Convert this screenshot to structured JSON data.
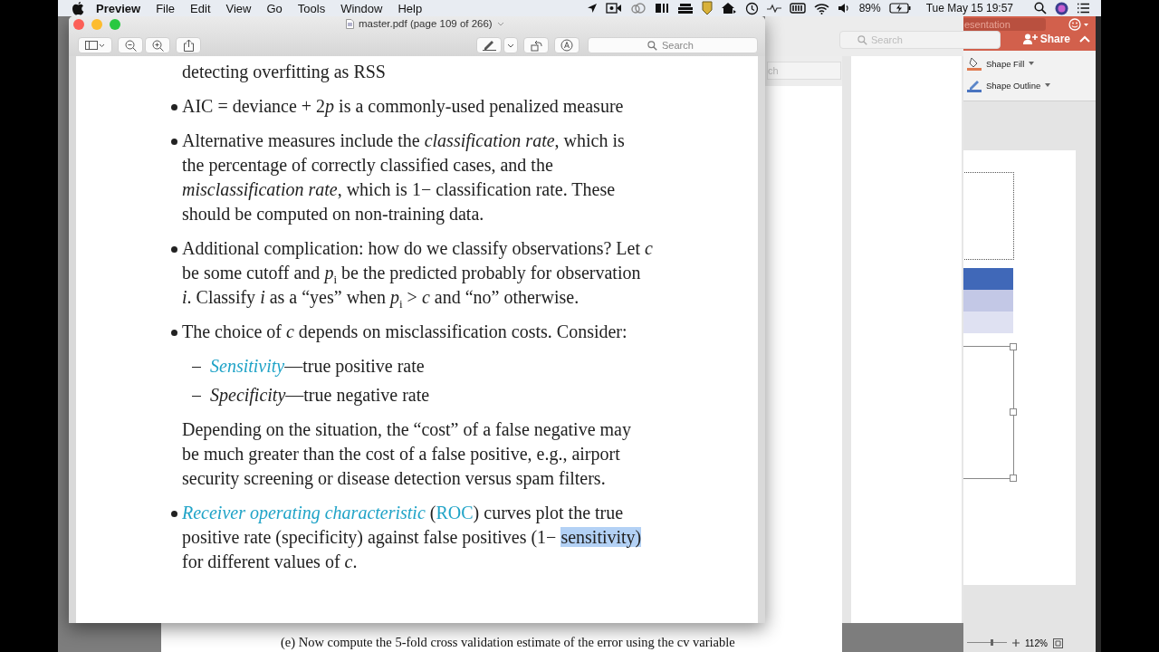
{
  "menu_bar": {
    "app": "Preview",
    "menus": [
      "File",
      "Edit",
      "View",
      "Go",
      "Tools",
      "Window",
      "Help"
    ],
    "battery": "89%",
    "clock": "Tue May 15  19:57"
  },
  "preview_window": {
    "title": "master.pdf (page 109 of 266)",
    "search": {
      "placeholder": "Search"
    },
    "document": [
      {
        "kind": "continuation",
        "lines": [
          [
            {
              "kind": "text",
              "t": "detecting overfitting as RSS"
            }
          ]
        ]
      },
      {
        "kind": "bullet",
        "lines": [
          [
            {
              "kind": "text",
              "t": "AIC = deviance + 2"
            },
            {
              "kind": "math",
              "t": "p"
            },
            {
              "kind": "text",
              "t": " is a commonly-used penalized measure"
            }
          ]
        ]
      },
      {
        "kind": "bullet",
        "lines": [
          [
            {
              "kind": "text",
              "t": "Alternative measures include the *classification rate*, which is"
            }
          ],
          [
            {
              "kind": "text",
              "t": "the percentage of correctly classified cases, and the"
            }
          ],
          [
            {
              "kind": "text",
              "t": "*misclassification rate*, which is 1− classification rate. These"
            }
          ],
          [
            {
              "kind": "text",
              "t": "should be computed on non-training data."
            }
          ]
        ]
      },
      {
        "kind": "bullet",
        "lines": [
          [
            {
              "kind": "text",
              "t": "Additional complication: how do we classify observations? Let *c*"
            }
          ],
          [
            {
              "kind": "text",
              "t": "be some cutoff and *p*$_{i}$ be the predicted probably for observation"
            }
          ],
          [
            {
              "kind": "text",
              "t": "*i*. Classify *i* as a “yes” when *p*$_{i}$ > *c* and “no” otherwise."
            }
          ]
        ]
      },
      {
        "kind": "bullet",
        "lines": [
          [
            {
              "kind": "text",
              "t": "The choice of *c* depends on misclassification costs. Consider:"
            }
          ]
        ]
      },
      {
        "kind": "dash",
        "lines": [
          [
            {
              "kind": "link",
              "italic": true,
              "t": "Sensitivity"
            },
            {
              "kind": "text",
              "t": "—true positive rate"
            }
          ]
        ]
      },
      {
        "kind": "dash",
        "lines": [
          [
            {
              "kind": "text",
              "t": "*Specificity*—true negative rate"
            }
          ]
        ]
      },
      {
        "kind": "paragraph",
        "lines": [
          [
            {
              "kind": "text",
              "t": "Depending on the situation, the “cost” of a false negative may"
            }
          ],
          [
            {
              "kind": "text",
              "t": "be much greater than the cost of a false positive, e.g., airport"
            }
          ],
          [
            {
              "kind": "text",
              "t": "security screening or disease detection versus spam filters."
            }
          ]
        ]
      },
      {
        "kind": "bullet",
        "lines": [
          [
            {
              "kind": "link",
              "italic": true,
              "t": "Receiver operating characteristic"
            },
            {
              "kind": "text",
              "t": " ("
            },
            {
              "kind": "link",
              "italic": false,
              "t": "ROC"
            },
            {
              "kind": "text",
              "t": ") curves plot the true"
            }
          ],
          [
            {
              "kind": "text",
              "t": "positive rate (specificity) against false positives (1− "
            },
            {
              "kind": "selection",
              "t": "sensitivity)"
            }
          ],
          [
            {
              "kind": "text",
              "t": "for different values of *c*."
            }
          ]
        ]
      }
    ]
  },
  "middle_window": {
    "search": {
      "placeholder": "Search"
    },
    "inner_search_text": "ch"
  },
  "back_document": {
    "line": "(e) Now compute the 5-fold cross validation estimate of the error using the cv variable"
  },
  "presentation_window": {
    "title_field": "esentation",
    "share": "Share",
    "ribbon": [
      {
        "kind": "fill",
        "label": "Shape Fill"
      },
      {
        "kind": "outline",
        "label": "Shape Outline"
      }
    ],
    "zoom_slider": {
      "level": 0.6
    },
    "zoom": "112%"
  }
}
